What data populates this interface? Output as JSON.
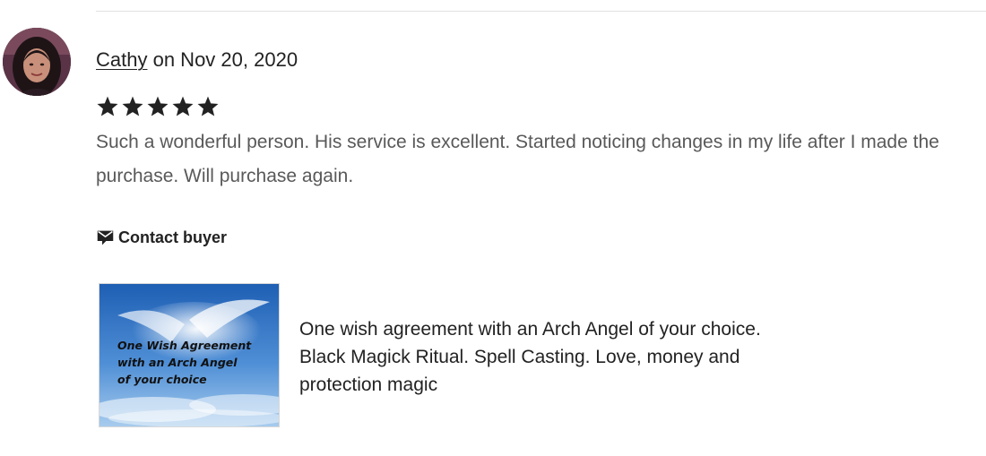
{
  "review": {
    "reviewer_name": "Cathy",
    "date_text": " on Nov 20, 2020",
    "rating": 5,
    "rating_max": 5,
    "text": "Such a wonderful person. His service is excellent. Started noticing changes in my life after I made the purchase. Will purchase again."
  },
  "contact": {
    "label": "Contact buyer",
    "icon": "message-icon"
  },
  "listing": {
    "image_caption_lines": [
      "One Wish Agreement",
      "with an Arch Angel",
      "of your choice"
    ],
    "title_lines": [
      "One wish agreement with an Arch Angel of your choice.",
      "Black Magick Ritual. Spell Casting. Love, money and",
      "protection magic"
    ]
  },
  "colors": {
    "text_primary": "#222222",
    "text_secondary": "#595959",
    "divider": "#e1e1e1",
    "sky_blue": "#2f6fc0"
  }
}
